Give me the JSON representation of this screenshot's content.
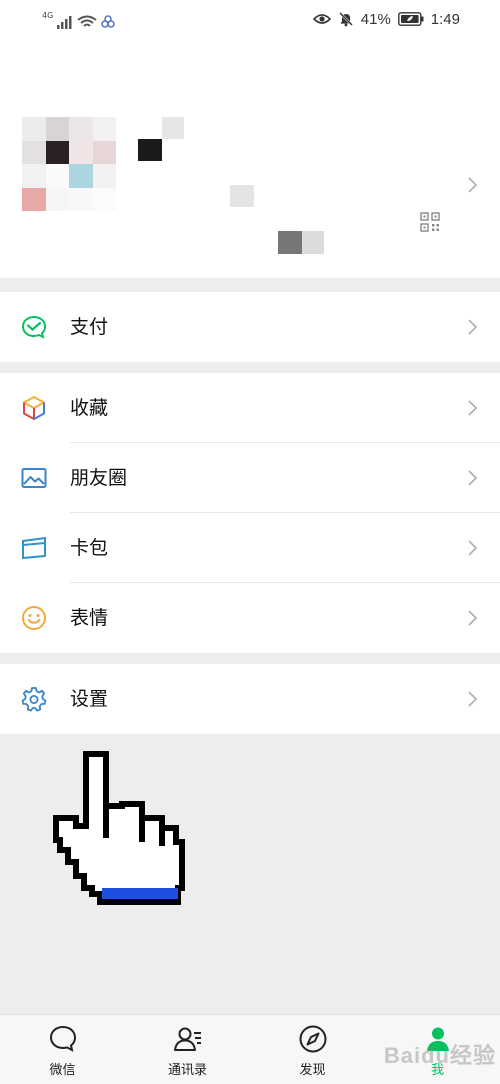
{
  "status_bar": {
    "network_label": "4G",
    "battery_percent": "41%",
    "time": "1:49"
  },
  "profile": {
    "qr_icon": "qr-code-icon",
    "chevron_icon": "chevron-right-icon"
  },
  "menu": {
    "pay": {
      "label": "支付",
      "icon": "wechat-pay-icon"
    },
    "favorites": {
      "label": "收藏",
      "icon": "cube-icon"
    },
    "moments": {
      "label": "朋友圈",
      "icon": "image-icon"
    },
    "cards": {
      "label": "卡包",
      "icon": "card-icon"
    },
    "stickers": {
      "label": "表情",
      "icon": "smile-icon"
    },
    "settings": {
      "label": "设置",
      "icon": "gear-icon"
    }
  },
  "tabbar": {
    "tabs": [
      {
        "label": "微信",
        "icon": "chat-bubble-icon"
      },
      {
        "label": "通讯录",
        "icon": "contacts-icon"
      },
      {
        "label": "发现",
        "icon": "compass-icon"
      },
      {
        "label": "我",
        "icon": "me-icon",
        "active": true
      }
    ]
  },
  "watermark": {
    "text": "Baidu经验"
  },
  "colors": {
    "accent_green": "#07c160",
    "background": "#ededed",
    "cursor_blue": "#1e4fe0"
  }
}
